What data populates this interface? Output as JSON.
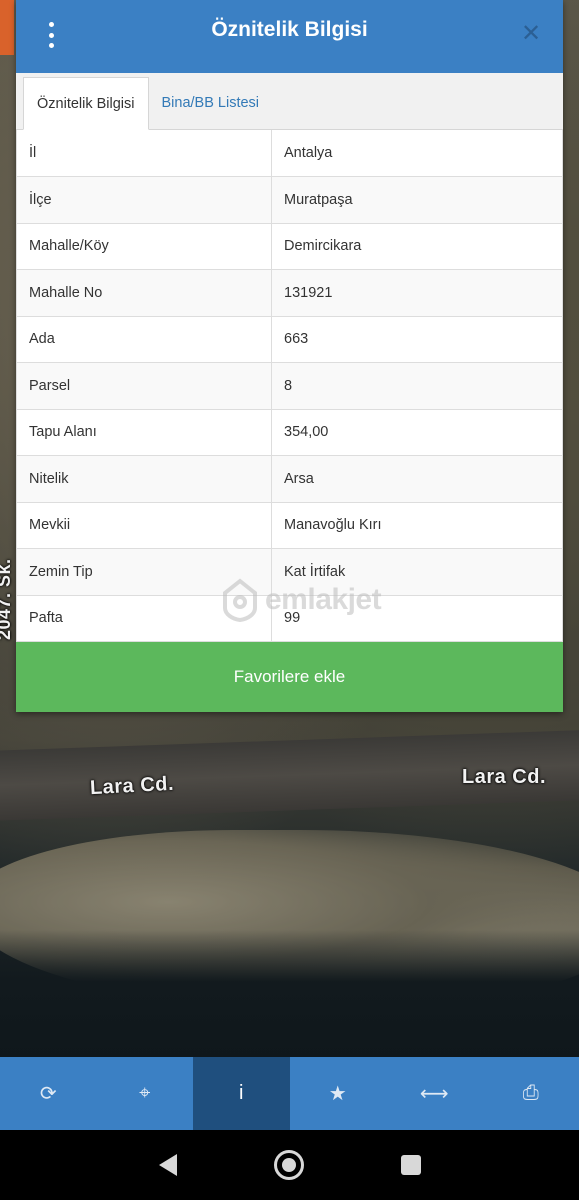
{
  "dialog": {
    "title": "Öznitelik Bilgisi",
    "tabs": [
      {
        "label": "Öznitelik Bilgisi",
        "active": true
      },
      {
        "label": "Bina/BB Listesi",
        "active": false
      }
    ],
    "rows": [
      {
        "key": "İl",
        "value": "Antalya"
      },
      {
        "key": "İlçe",
        "value": "Muratpaşa"
      },
      {
        "key": "Mahalle/Köy",
        "value": "Demircikara"
      },
      {
        "key": "Mahalle No",
        "value": "131921"
      },
      {
        "key": "Ada",
        "value": "663"
      },
      {
        "key": "Parsel",
        "value": "8"
      },
      {
        "key": "Tapu Alanı",
        "value": "354,00"
      },
      {
        "key": "Nitelik",
        "value": "Arsa"
      },
      {
        "key": "Mevkii",
        "value": "Manavoğlu Kırı"
      },
      {
        "key": "Zemin Tip",
        "value": "Kat İrtifak"
      },
      {
        "key": "Pafta",
        "value": "99"
      }
    ],
    "favorite_label": "Favorilere ekle",
    "close_glyph": "✕"
  },
  "watermark": {
    "text": "emlakjet"
  },
  "map_labels": {
    "road_left": "Lara Cd.",
    "road_right": "Lara Cd.",
    "street": "2047. Sk."
  },
  "toolbar": {
    "items": [
      {
        "name": "refresh-icon",
        "glyph": "⟳",
        "active": false
      },
      {
        "name": "locate-icon",
        "glyph": "⌖",
        "active": false
      },
      {
        "name": "info-icon",
        "glyph": "i",
        "active": true
      },
      {
        "name": "star-icon",
        "glyph": "★",
        "active": false
      },
      {
        "name": "measure-icon",
        "glyph": "⟷",
        "active": false
      },
      {
        "name": "print-icon",
        "glyph": "⎙",
        "active": false
      }
    ]
  },
  "colors": {
    "header": "#3b80c4",
    "favorite": "#5cb85c",
    "tab_link": "#337ab7",
    "toolbar_active": "#1f4f7e"
  }
}
